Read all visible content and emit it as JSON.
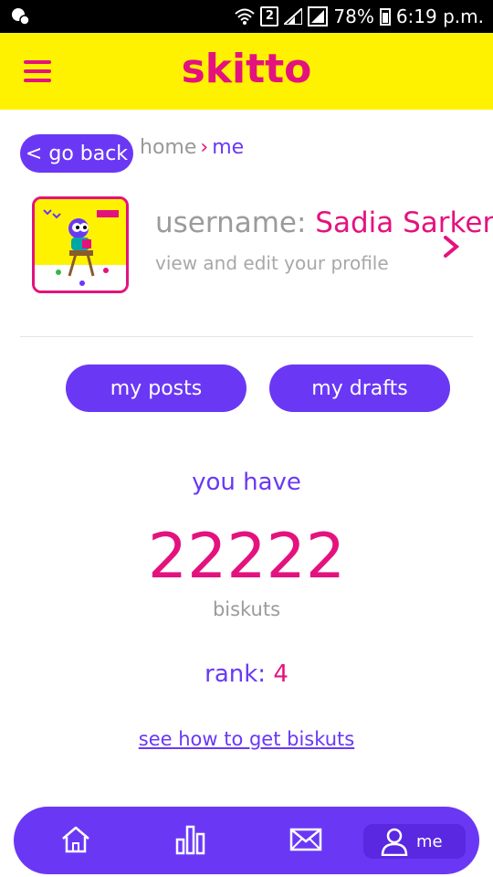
{
  "status_bar": {
    "sim_number": "2",
    "battery": "78%",
    "time": "6:19 p.m."
  },
  "header": {
    "title": "skitto",
    "menu_icon": "hamburger-menu-icon"
  },
  "breadcrumb": {
    "back_label": "< go back",
    "home": "home",
    "separator": "›",
    "current": "me"
  },
  "profile": {
    "label": "username:",
    "name": "Sadia Sarker",
    "subtitle": "view and edit your profile"
  },
  "actions": {
    "posts": "my posts",
    "drafts": "my drafts"
  },
  "stats": {
    "you_have": "you have",
    "amount": "22222",
    "unit": "biskuts",
    "rank_label": "rank:",
    "rank_value": "4",
    "how_to_link": "see how to get biskuts"
  },
  "bottom_nav": {
    "items": [
      {
        "icon": "home-icon"
      },
      {
        "icon": "bar-chart-icon"
      },
      {
        "icon": "mail-icon"
      },
      {
        "icon": "user-icon",
        "label": "me"
      }
    ]
  },
  "colors": {
    "brand_pink": "#e4127e",
    "brand_purple": "#6a38f5",
    "header_yellow": "#fff200"
  }
}
